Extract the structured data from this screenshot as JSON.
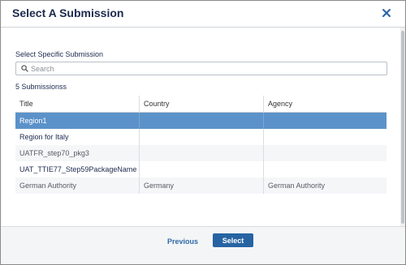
{
  "dialog": {
    "title": "Select A Submission",
    "close_icon": "close-icon"
  },
  "search": {
    "label": "Select Specific Submission",
    "placeholder": "Search",
    "value": "",
    "icon": "search-icon"
  },
  "results": {
    "count_label": "5 Submissionss"
  },
  "table": {
    "columns": [
      "Title",
      "Country",
      "Agency"
    ],
    "rows": [
      {
        "title": "Region1",
        "country": "",
        "agency": "",
        "selected": true
      },
      {
        "title": "Region for Italy",
        "country": "",
        "agency": "",
        "selected": false
      },
      {
        "title": "UATFR_step70_pkg3",
        "country": "",
        "agency": "",
        "selected": false
      },
      {
        "title": "UAT_TTIE77_Step59PackageName",
        "country": "",
        "agency": "",
        "selected": false
      },
      {
        "title": "German Authority",
        "country": "Germany",
        "agency": "German Authority",
        "selected": false
      }
    ]
  },
  "footer": {
    "previous_label": "Previous",
    "select_label": "Select"
  },
  "colors": {
    "selected_row": "#5b92c9",
    "primary_button": "#2763a3",
    "title_text": "#1d2a4d"
  }
}
